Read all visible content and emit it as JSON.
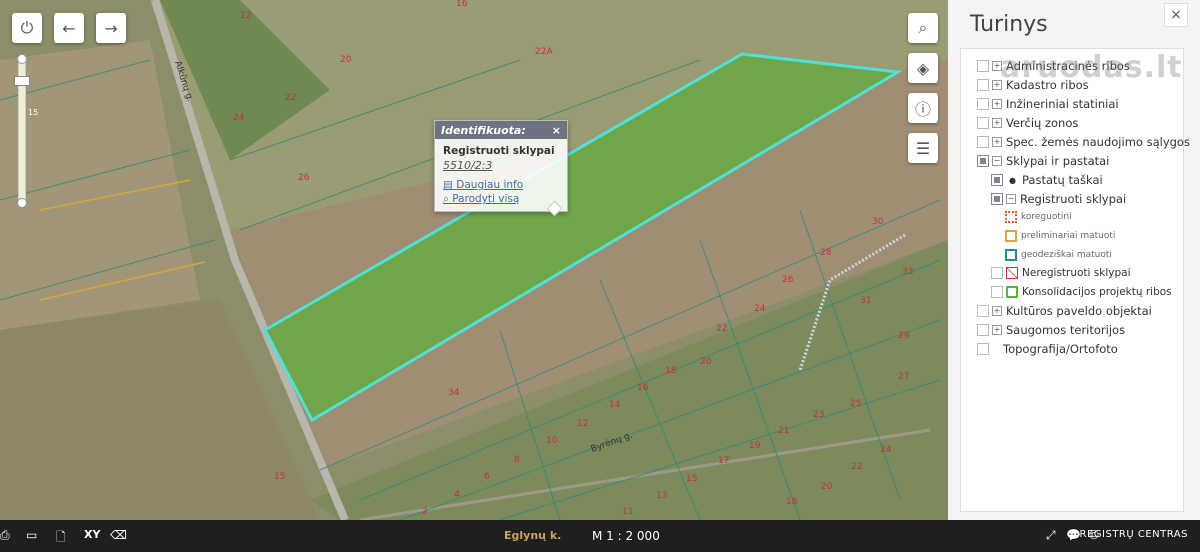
{
  "map": {
    "plot_labels": [
      "12",
      "16",
      "20",
      "22",
      "22A",
      "24",
      "26",
      "30",
      "33",
      "31",
      "29",
      "27",
      "28",
      "26",
      "24",
      "22",
      "20",
      "18",
      "16",
      "14",
      "12",
      "10",
      "8",
      "6",
      "4",
      "2",
      "11",
      "13",
      "15",
      "17",
      "19",
      "21",
      "23",
      "25",
      "22",
      "24",
      "20",
      "18",
      "15",
      "34"
    ],
    "road_labels": [
      "Alkūnų g.",
      "Byrėnų g."
    ]
  },
  "controls": {
    "power": "power-icon",
    "back": "arrow-left-icon",
    "forward": "arrow-right-icon",
    "zoom_ticks": [
      "15"
    ]
  },
  "popup": {
    "header": "Identifikuota:",
    "close": "×",
    "title": "Registruoti sklypai",
    "number": "5510/2:3",
    "more_info": "Daugiau info",
    "show_all": "Parodyti visą"
  },
  "panel": {
    "title": "Turinys",
    "close": "×",
    "watermark": "aruodas.lt",
    "layers": [
      {
        "label": "Administracinės ribos"
      },
      {
        "label": "Kadastro ribos"
      },
      {
        "label": "Inžineriniai statiniai"
      },
      {
        "label": "Verčių zonos"
      },
      {
        "label": "Spec. žemės naudojimo sąlygos"
      },
      {
        "label": "Sklypai ir pastatai"
      },
      {
        "label": "Pastatų taškai"
      },
      {
        "label": "Registruoti sklypai"
      },
      {
        "label": "koreguotini"
      },
      {
        "label": "preliminariai matuoti"
      },
      {
        "label": "geodeziškai matuoti"
      },
      {
        "label": "Neregistruoti sklypai"
      },
      {
        "label": "Konsolidacijos projektų ribos"
      },
      {
        "label": "Kultūros paveldo objektai"
      },
      {
        "label": "Saugomos teritorijos"
      },
      {
        "label": "Topografija/Ortofoto"
      }
    ]
  },
  "bottom": {
    "place": "Eglynų k.",
    "scale": "M 1 : 2 000",
    "brand": "REGISTRŲ CENTRAS",
    "xy": "XY"
  },
  "colors": {
    "highlight": "#4fe0d6",
    "field": "#6fa64a",
    "koreguotini": "#d9602d",
    "preliminariai": "#d8a63a",
    "geodeziskai": "#1f8f8f",
    "neregistruoti": "#c8303c",
    "konsolidacijos": "#59b23a"
  }
}
